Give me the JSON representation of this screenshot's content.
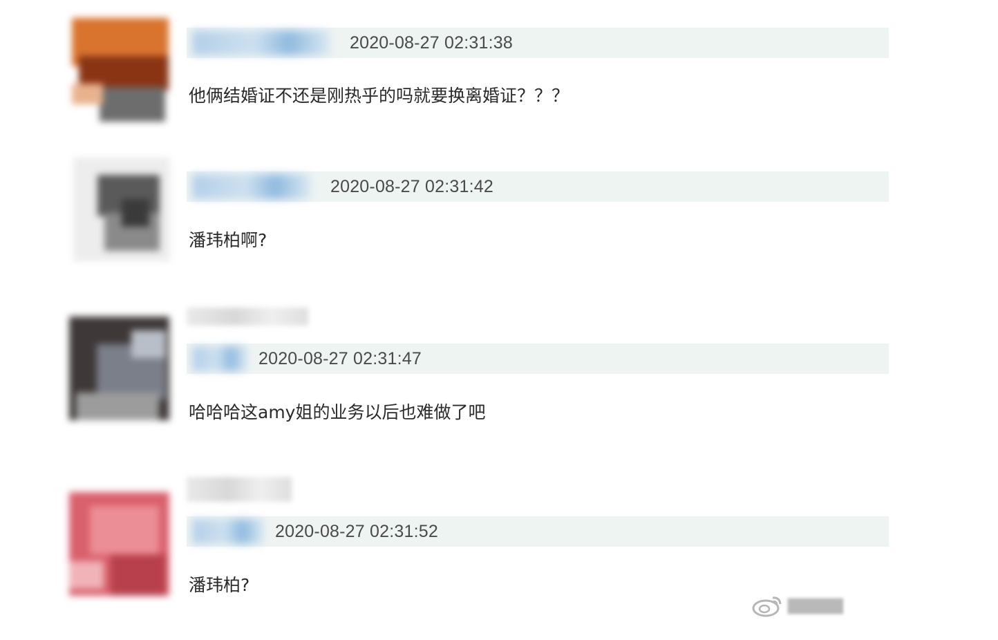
{
  "comments": [
    {
      "timestamp": "2020-08-27 02:31:38",
      "text": "他俩结婚证不还是刚热乎的吗就要换离婚证？？？",
      "avatar_color": "#c8581e"
    },
    {
      "timestamp": "2020-08-27 02:31:42",
      "text": "潘玮柏啊?",
      "avatar_color": "#555555"
    },
    {
      "timestamp": "2020-08-27 02:31:47",
      "text": "哈哈哈这amy姐的业务以后也难做了吧",
      "avatar_color": "#4a4444"
    },
    {
      "timestamp": "2020-08-27 02:31:52",
      "text": "潘玮柏?",
      "avatar_color": "#d8606e"
    }
  ],
  "watermark": {
    "icon": "weibo-logo-icon"
  },
  "colors": {
    "meta_bar_bg": "#eef4f2",
    "timestamp_text": "#4a4a4a",
    "comment_text": "#2a2a2a"
  }
}
